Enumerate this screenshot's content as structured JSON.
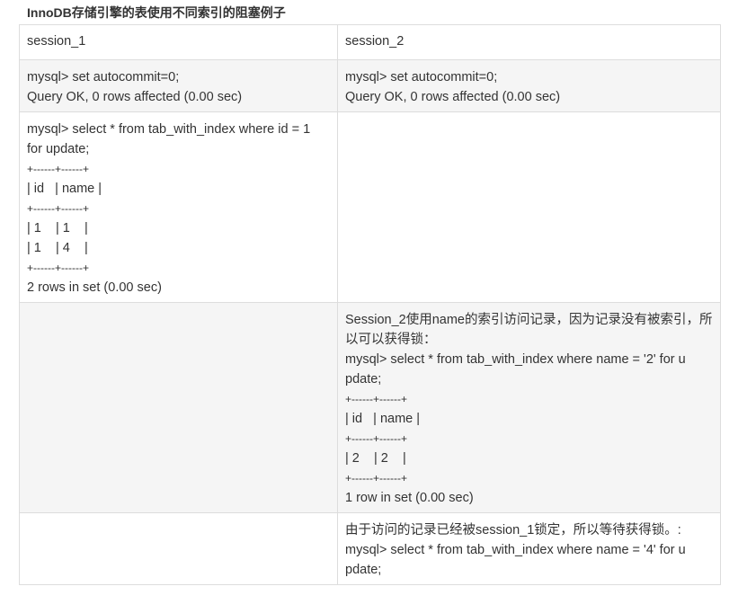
{
  "caption": "InnoDB存储引擎的表使用不同索引的阻塞例子",
  "table": {
    "headers": [
      "session_1",
      "session_2"
    ],
    "rows": [
      {
        "shade": true,
        "cell1": [
          "mysql> set autocommit=0;",
          "Query OK, 0 rows affected (0.00 sec)"
        ],
        "cell2": [
          "mysql> set autocommit=0;",
          "Query OK, 0 rows affected (0.00 sec)"
        ]
      },
      {
        "shade": false,
        "cell1": [
          "mysql> select * from tab_with_index where id = 1",
          "for update;",
          "+------+------+",
          "| id   | name |",
          "+------+------+",
          "| 1    | 1    |",
          "| 1    | 4    |",
          "+------+------+",
          "2 rows in set (0.00 sec)"
        ],
        "cell2": []
      },
      {
        "shade": true,
        "cell1": [],
        "cell2": [
          "Session_2使用name的索引访问记录，因为记录没有被索引，所",
          "以可以获得锁：",
          "mysql> select * from tab_with_index where name = '2' for u",
          "pdate;",
          "+------+------+",
          "| id   | name |",
          "+------+------+",
          "| 2    | 2    |",
          "+------+------+",
          "1 row in set (0.00 sec)"
        ]
      },
      {
        "shade": false,
        "cell1": [],
        "cell2": [
          "由于访问的记录已经被session_1锁定，所以等待获得锁。:",
          "mysql> select * from tab_with_index where name = '4' for u",
          "pdate;"
        ]
      }
    ]
  }
}
